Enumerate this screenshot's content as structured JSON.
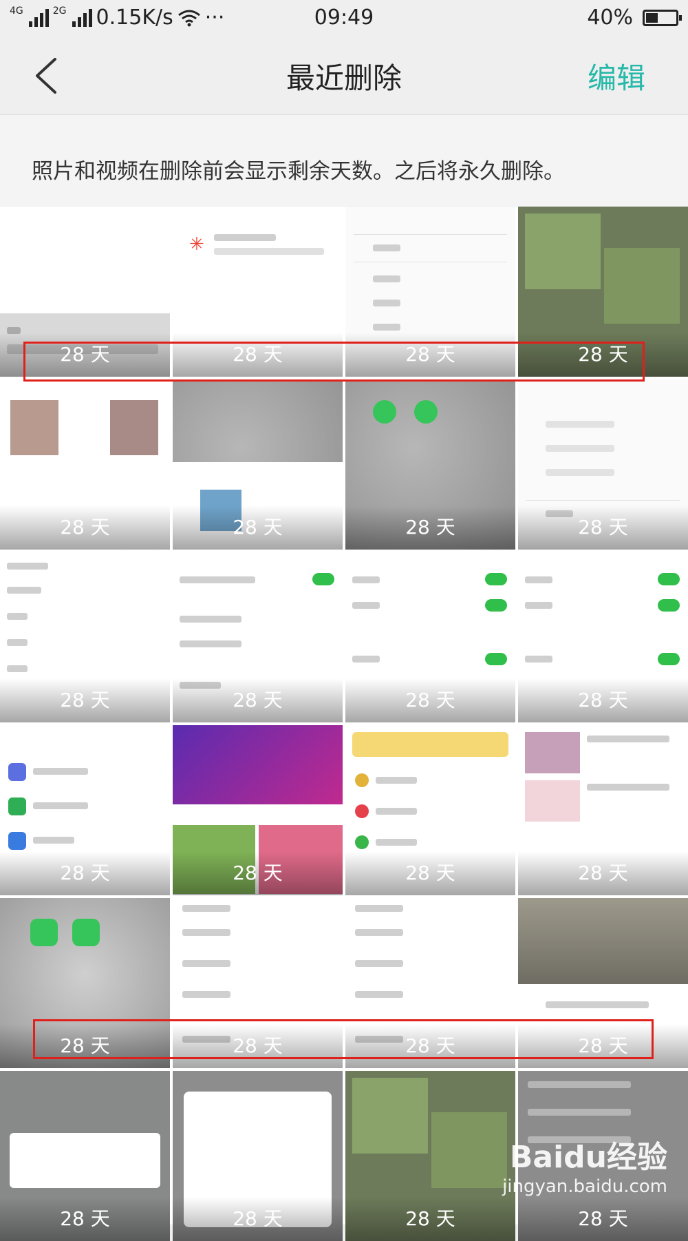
{
  "status_bar": {
    "network1": "4G",
    "network2": "2G",
    "speed": "0.15K/s",
    "more": "···",
    "time": "09:49",
    "battery_text": "40%",
    "battery_level": 0.4
  },
  "nav": {
    "title": "最近删除",
    "edit": "编辑"
  },
  "info": {
    "text": "照片和视频在删除前会显示剩余天数。之后将永久删除。"
  },
  "tiles": [
    {
      "days": "28 天"
    },
    {
      "days": "28 天"
    },
    {
      "days": "28 天"
    },
    {
      "days": "28 天"
    },
    {
      "days": "28 天"
    },
    {
      "days": "28 天"
    },
    {
      "days": "28 天"
    },
    {
      "days": "28 天"
    },
    {
      "days": "28 天"
    },
    {
      "days": "28 天"
    },
    {
      "days": "28 天"
    },
    {
      "days": "28 天"
    },
    {
      "days": "28 天"
    },
    {
      "days": "28 天"
    },
    {
      "days": "28 天"
    },
    {
      "days": "28 天"
    },
    {
      "days": "28 天"
    },
    {
      "days": "28 天"
    },
    {
      "days": "28 天"
    },
    {
      "days": "28 天"
    },
    {
      "days": "28 天"
    },
    {
      "days": "28 天"
    },
    {
      "days": "28 天"
    },
    {
      "days": "28 天"
    }
  ],
  "watermark": {
    "logo": "Baidu经验",
    "url": "jingyan.baidu.com"
  },
  "colors": {
    "accent": "#26b8a8",
    "highlight_box": "#e0201a"
  }
}
